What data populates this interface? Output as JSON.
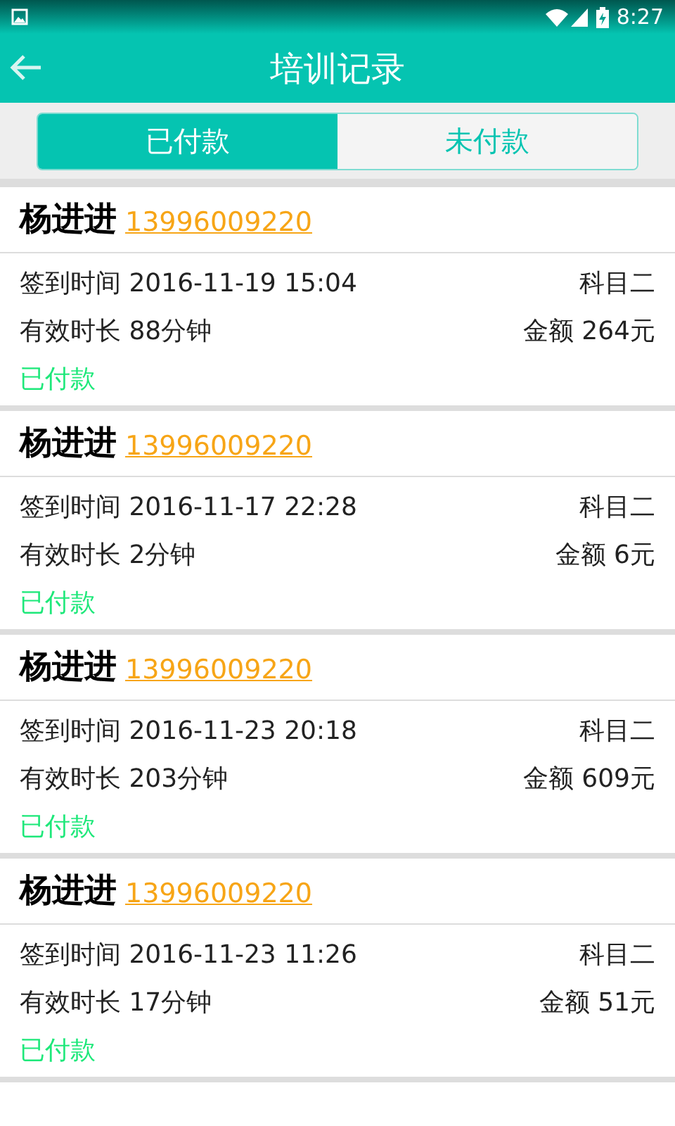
{
  "status_bar": {
    "time": "8:27"
  },
  "header": {
    "title": "培训记录"
  },
  "tabs": [
    {
      "label": "已付款",
      "selected": true
    },
    {
      "label": "未付款",
      "selected": false
    }
  ],
  "records": [
    {
      "name": "杨进进",
      "phone": "13996009220",
      "checkin_label": "签到时间",
      "checkin_time": "2016-11-19 15:04",
      "subject": "科目二",
      "duration_label": "有效时长",
      "duration": "88分钟",
      "amount_label": "金额",
      "amount": "264元",
      "status": "已付款"
    },
    {
      "name": "杨进进",
      "phone": "13996009220",
      "checkin_label": "签到时间",
      "checkin_time": "2016-11-17 22:28",
      "subject": "科目二",
      "duration_label": "有效时长",
      "duration": "2分钟",
      "amount_label": "金额",
      "amount": "6元",
      "status": "已付款"
    },
    {
      "name": "杨进进",
      "phone": "13996009220",
      "checkin_label": "签到时间",
      "checkin_time": "2016-11-23 20:18",
      "subject": "科目二",
      "duration_label": "有效时长",
      "duration": "203分钟",
      "amount_label": "金额",
      "amount": "609元",
      "status": "已付款"
    },
    {
      "name": "杨进进",
      "phone": "13996009220",
      "checkin_label": "签到时间",
      "checkin_time": "2016-11-23 11:26",
      "subject": "科目二",
      "duration_label": "有效时长",
      "duration": "17分钟",
      "amount_label": "金额",
      "amount": "51元",
      "status": "已付款"
    }
  ]
}
